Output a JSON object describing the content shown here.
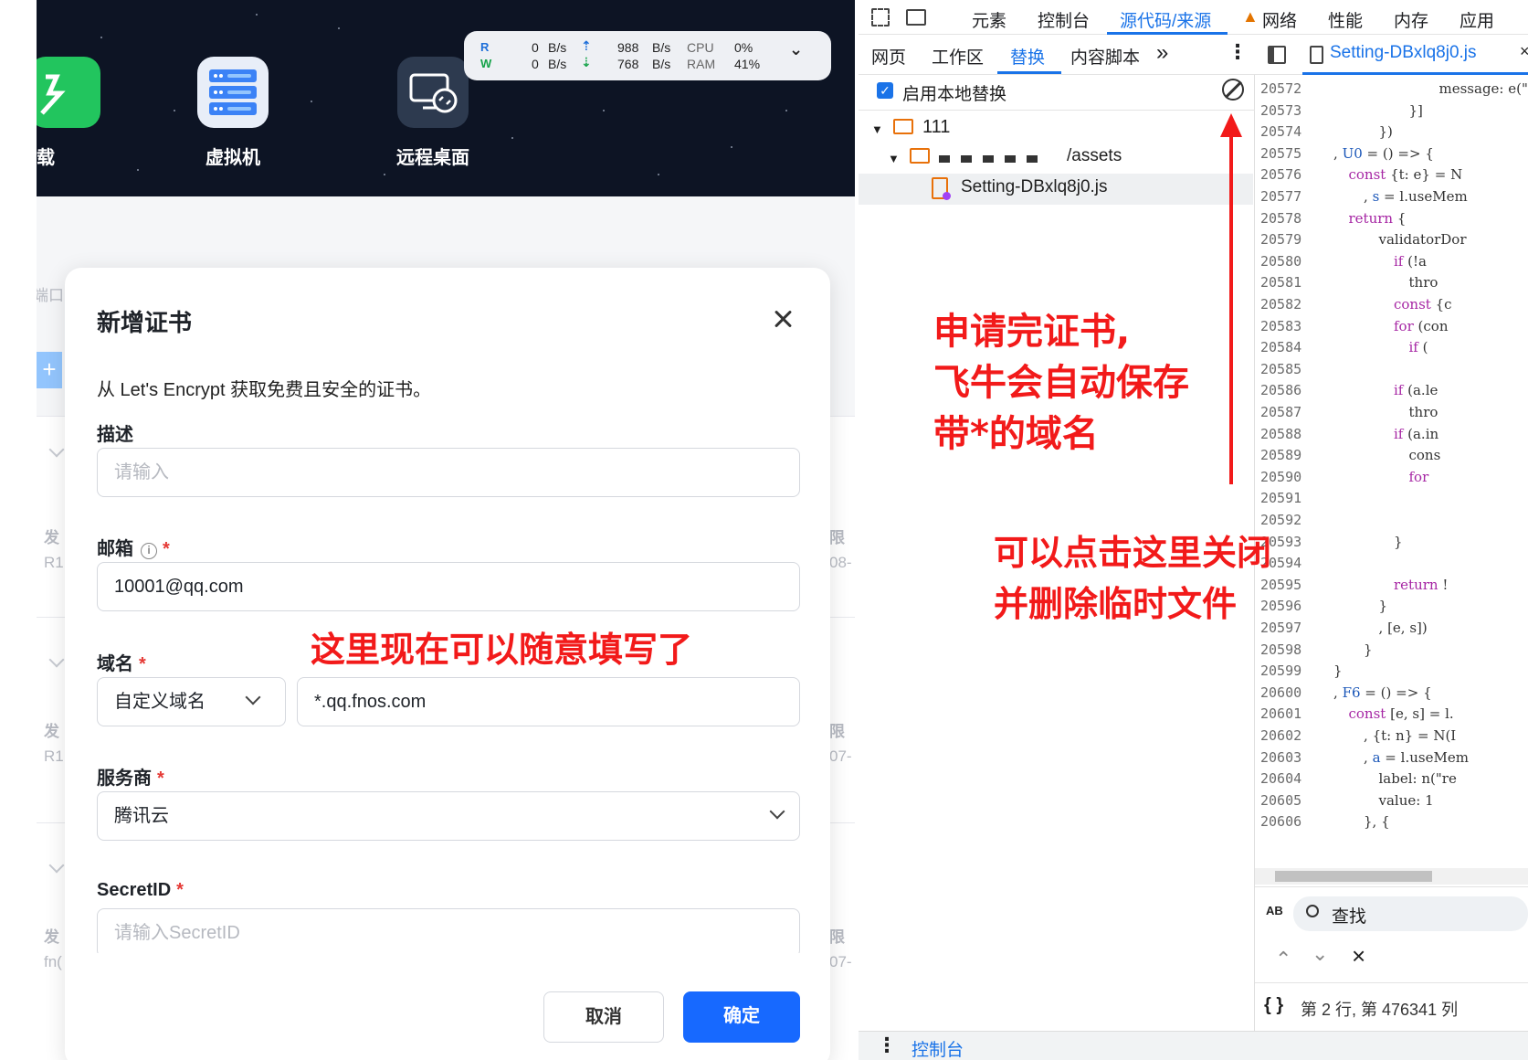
{
  "desktop": {
    "apps": [
      {
        "label": "载",
        "icon": "download-app-icon",
        "color": "#22c55e"
      },
      {
        "label": "虚拟机",
        "icon": "virtual-machine-icon",
        "color": "#3b82f6"
      },
      {
        "label": "远程桌面",
        "icon": "remote-desktop-icon",
        "color": "#2d3a4f"
      }
    ],
    "monitor": {
      "r_label": "R",
      "w_label": "W",
      "r_rate": "0",
      "w_rate": "0",
      "rate_unit": "B/s",
      "net_up": "988",
      "net_down": "768",
      "net_unit": "B/s",
      "cpu_label": "CPU",
      "cpu_value": "0%",
      "ram_label": "RAM",
      "ram_value": "41%"
    },
    "background_fragments": [
      "端口",
      "发",
      "R1",
      "限",
      "08-",
      "发",
      "R1",
      "限",
      "07-",
      "发",
      "fn(",
      "限",
      "07-"
    ]
  },
  "dialog": {
    "title": "新增证书",
    "description": "从 Let's Encrypt 获取免费且安全的证书。",
    "fields": {
      "desc_label": "描述",
      "desc_placeholder": "请输入",
      "email_label": "邮箱",
      "email_value": "10001@qq.com",
      "domain_label": "域名",
      "domain_type": "自定义域名",
      "domain_value": "*.qq.fnos.com",
      "provider_label": "服务商",
      "provider_value": "腾讯云",
      "secret_label": "SecretID",
      "secret_placeholder": "请输入SecretID"
    },
    "buttons": {
      "cancel": "取消",
      "confirm": "确定"
    },
    "required_mark": "*",
    "info_glyph": "i"
  },
  "devtools": {
    "main_tabs": [
      "元素",
      "控制台",
      "源代码/来源",
      "网络",
      "性能",
      "内存",
      "应用"
    ],
    "active_main_tab": "源代码/来源",
    "sub_tabs": [
      "网页",
      "工作区",
      "替换",
      "内容脚本"
    ],
    "active_sub_tab": "替换",
    "more_tabs": "»",
    "enable_overrides_label": "启用本地替换",
    "tree": {
      "root": "111",
      "folder": "/assets",
      "file": "Setting-DBxlq8j0.js"
    },
    "editor_tab": "Setting-DBxlq8j0.js",
    "code_lines": [
      {
        "n": "20572",
        "t": "message: e(\"",
        "i": 7
      },
      {
        "n": "20573",
        "t": "}]",
        "i": 5
      },
      {
        "n": "20574",
        "t": "})",
        "i": 3
      },
      {
        "n": "20575",
        "t": ", U0 = () => {",
        "i": 0
      },
      {
        "n": "20576",
        "t": "const {t: e} = N",
        "i": 1
      },
      {
        "n": "20577",
        "t": ", s = l.useMem",
        "i": 2
      },
      {
        "n": "20578",
        "t": "return {",
        "i": 1
      },
      {
        "n": "20579",
        "t": "validatorDor",
        "i": 3
      },
      {
        "n": "20580",
        "t": "if (!a",
        "i": 4
      },
      {
        "n": "20581",
        "t": "thro",
        "i": 5
      },
      {
        "n": "20582",
        "t": "const {c",
        "i": 4
      },
      {
        "n": "20583",
        "t": "for (con",
        "i": 4
      },
      {
        "n": "20584",
        "t": "if (",
        "i": 5
      },
      {
        "n": "20585",
        "t": "",
        "i": 0
      },
      {
        "n": "20586",
        "t": "if (a.le",
        "i": 4
      },
      {
        "n": "20587",
        "t": "thro",
        "i": 5
      },
      {
        "n": "20588",
        "t": "if (a.in",
        "i": 4
      },
      {
        "n": "20589",
        "t": "cons",
        "i": 5
      },
      {
        "n": "20590",
        "t": "for",
        "i": 5
      },
      {
        "n": "20591",
        "t": "",
        "i": 0
      },
      {
        "n": "20592",
        "t": "",
        "i": 0
      },
      {
        "n": "20593",
        "t": "}",
        "i": 4
      },
      {
        "n": "20594",
        "t": "",
        "i": 0
      },
      {
        "n": "20595",
        "t": "return !",
        "i": 4
      },
      {
        "n": "20596",
        "t": "}",
        "i": 3
      },
      {
        "n": "20597",
        "t": ", [e, s])",
        "i": 3
      },
      {
        "n": "20598",
        "t": "}",
        "i": 2
      },
      {
        "n": "20599",
        "t": "}",
        "i": 0
      },
      {
        "n": "20600",
        "t": ", F6 = () => {",
        "i": 0
      },
      {
        "n": "20601",
        "t": "const [e, s] = l.",
        "i": 1
      },
      {
        "n": "20602",
        "t": ", {t: n} = N(I",
        "i": 2
      },
      {
        "n": "20603",
        "t": ", a = l.useMem",
        "i": 2
      },
      {
        "n": "20604",
        "t": "label: n(\"re",
        "i": 3
      },
      {
        "n": "20605",
        "t": "value: 1",
        "i": 3
      },
      {
        "n": "20606",
        "t": "}, {",
        "i": 2
      }
    ],
    "search_placeholder": "查找",
    "status_braces": "{ }",
    "status_position": "第 2 行, 第 476341 列",
    "drawer_label": "控制台",
    "case_toggle_label": "AB"
  },
  "annotations": {
    "free_input": "这里现在可以随意填写了",
    "auto_save": [
      "申请完证书,",
      "飞牛会自动保存",
      "带*的域名"
    ],
    "click_close": [
      "可以点击这里关闭",
      "并删除临时文件"
    ],
    "color": "#f21a1a"
  }
}
